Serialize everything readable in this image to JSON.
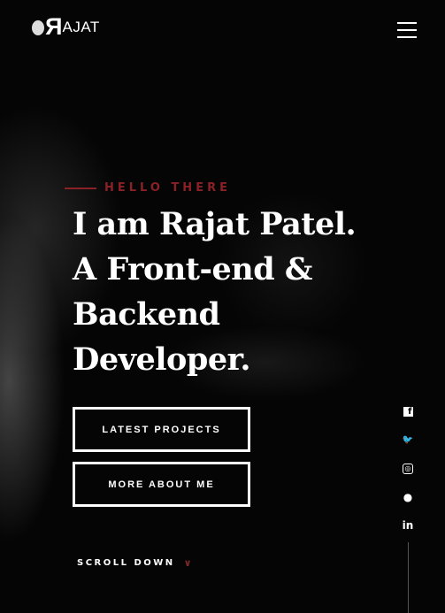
{
  "header": {
    "logo_mark": "R",
    "logo_text": "AJAT",
    "menu_icon": "hamburger-icon"
  },
  "hero": {
    "eyebrow": "HELLO THERE",
    "headline": [
      "I am Rajat Patel.",
      "A Front-end &",
      "Backend",
      "Developer."
    ],
    "buttons": {
      "projects": "LATEST PROJECTS",
      "about": "MORE ABOUT ME"
    },
    "scroll": "SCROLL DOWN",
    "scroll_icon": "chevron-down-icon"
  },
  "social": [
    {
      "name": "facebook-icon",
      "glyph": "f"
    },
    {
      "name": "twitter-icon",
      "glyph": "🐦"
    },
    {
      "name": "instagram-icon",
      "glyph": "◎"
    },
    {
      "name": "github-icon",
      "glyph": "●"
    },
    {
      "name": "linkedin-icon",
      "glyph": "in"
    }
  ],
  "colors": {
    "accent": "#8a2127",
    "background": "#050505",
    "text": "#ffffff"
  }
}
